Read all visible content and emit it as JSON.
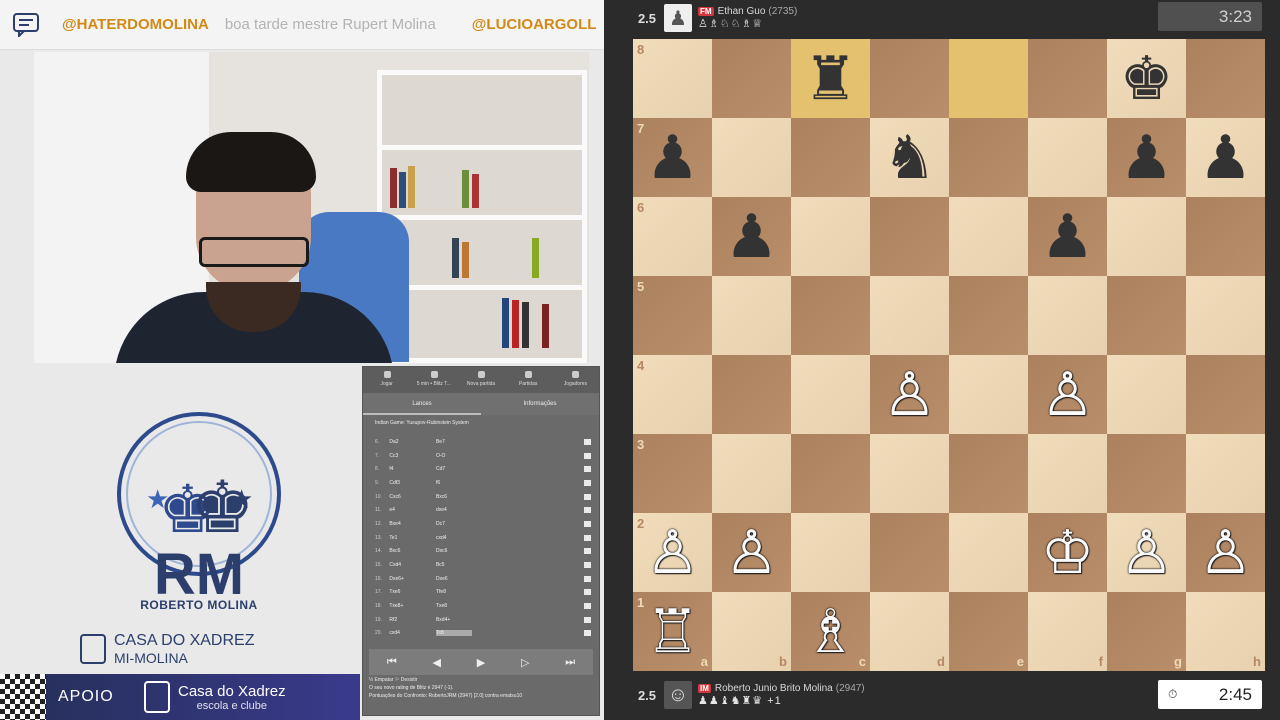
{
  "ticker": {
    "chat_icon": "chat-bubble-icon",
    "items": [
      {
        "user": "@HATERDOMOLINA",
        "message": "boa tarde mestre Rupert Molina"
      },
      {
        "user": "@LUCIOARGOLL",
        "message": ""
      }
    ]
  },
  "brand": {
    "logo_letters": "RM",
    "name": "ROBERTO MOLINA",
    "casa_line1": "CASA DO XADREZ",
    "casa_line2": "MI-MOLINA"
  },
  "apoio": {
    "label": "APOIO",
    "line1": "Casa do Xadrez",
    "line2": "escola e clube"
  },
  "mini_panel": {
    "nav": [
      "Jogar",
      "5 min • Blitz T...",
      "Nova partida",
      "Partidas",
      "Jogadores"
    ],
    "subtabs": [
      "Lances",
      "Informações"
    ],
    "opening": "Indian Game: Yusupov-Rubinstein System",
    "moves": [
      {
        "no": "6.",
        "w": "Da2",
        "b": "Be7"
      },
      {
        "no": "7.",
        "w": "Cc3",
        "b": "O-O"
      },
      {
        "no": "8.",
        "w": "f4",
        "b": "Cd7"
      },
      {
        "no": "9.",
        "w": "Cdf3",
        "b": "f6"
      },
      {
        "no": "10.",
        "w": "Cxc6",
        "b": "Bxc6"
      },
      {
        "no": "11.",
        "w": "e4",
        "b": "dxe4"
      },
      {
        "no": "12.",
        "w": "Bxe4",
        "b": "Dc7"
      },
      {
        "no": "13.",
        "w": "Te1",
        "b": "cxd4"
      },
      {
        "no": "14.",
        "w": "Bxc6",
        "b": "Dxc6"
      },
      {
        "no": "15.",
        "w": "Cxd4",
        "b": "Bc5"
      },
      {
        "no": "16.",
        "w": "Dxe6+",
        "b": "Dxe6"
      },
      {
        "no": "17.",
        "w": "Txe6",
        "b": "Tfe8"
      },
      {
        "no": "18.",
        "w": "Txe8+",
        "b": "Txe8"
      },
      {
        "no": "19.",
        "w": "Rf2",
        "b": "Bxd4+"
      },
      {
        "no": "20.",
        "w": "cxd4",
        "b": "Tc8"
      }
    ],
    "controls": [
      "⏮",
      "◀",
      "▶",
      "▷",
      "⏭"
    ],
    "footer": [
      "½ Empatar  ⚐ Desistir",
      "O seu novo rating de Blitz é 2947 (-1).",
      "Pontuações do Confronto: RobertoJRM (2947) [2.0] contra ematsu10"
    ]
  },
  "top_player": {
    "score": "2.5",
    "title": "FM",
    "name": "Ethan Guo",
    "rating": "(2735)",
    "captured": "♙♗♘♘♗♕",
    "clock": "3:23"
  },
  "bottom_player": {
    "score": "2.5",
    "title": "IM",
    "name": "Roberto Junio Brito Molina",
    "rating": "(2947)",
    "captured": "♟♟♝♞♜♛ +1",
    "clock": "2:45",
    "clock_icon": "clock-icon"
  },
  "board": {
    "files": [
      "a",
      "b",
      "c",
      "d",
      "e",
      "f",
      "g",
      "h"
    ],
    "ranks": [
      "8",
      "7",
      "6",
      "5",
      "4",
      "3",
      "2",
      "1"
    ],
    "highlight": [
      "c8",
      "e8"
    ],
    "pieces": {
      "c8": "br",
      "g8": "bk",
      "a7": "bp",
      "d7": "bn",
      "g7": "bp",
      "h7": "bp",
      "b6": "bp",
      "f6": "bp",
      "d4": "wp",
      "f4": "wp",
      "a2": "wp",
      "b2": "wp",
      "f2": "wk",
      "g2": "wp",
      "h2": "wp",
      "a1": "wr",
      "c1": "wb"
    }
  }
}
